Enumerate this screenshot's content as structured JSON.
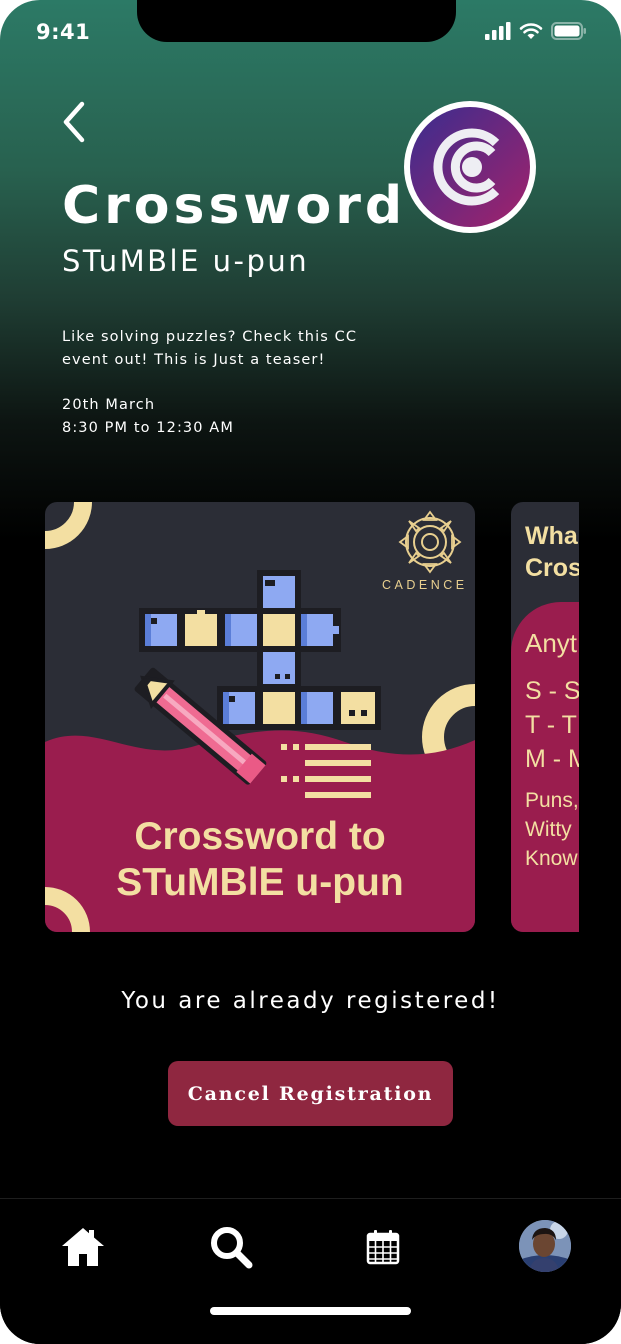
{
  "status_bar": {
    "time": "9:41"
  },
  "event": {
    "title": "Crossword",
    "subtitle": "STuMBlE u-pun",
    "description": "Like solving puzzles? Check this CC event out! This is Just a teaser!",
    "date": "20th March",
    "time_range": "8:30 PM to 12:30 AM"
  },
  "poster": {
    "brand": "CADENCE",
    "title_line1": "Crossword to",
    "title_line2": "STuMBlE u-pun"
  },
  "info_card": {
    "heading_line1": "Wha",
    "heading_line2": "Cros",
    "any": "Anyt",
    "list": [
      "S - S",
      "T - T",
      "M - M"
    ],
    "footer": [
      "Puns,",
      "Witty",
      "Know"
    ]
  },
  "registration": {
    "message": "You are already registered!",
    "cancel_label": "Cancel Registration"
  },
  "colors": {
    "accent": "#8f2740",
    "poster_bg": "#2b2d36",
    "poster_wave": "#9a1d4e",
    "poster_text": "#f3dfa2"
  },
  "tabs": [
    {
      "name": "home",
      "icon": "home-icon"
    },
    {
      "name": "search",
      "icon": "search-icon"
    },
    {
      "name": "calendar",
      "icon": "calendar-icon"
    },
    {
      "name": "profile",
      "icon": "avatar"
    }
  ]
}
